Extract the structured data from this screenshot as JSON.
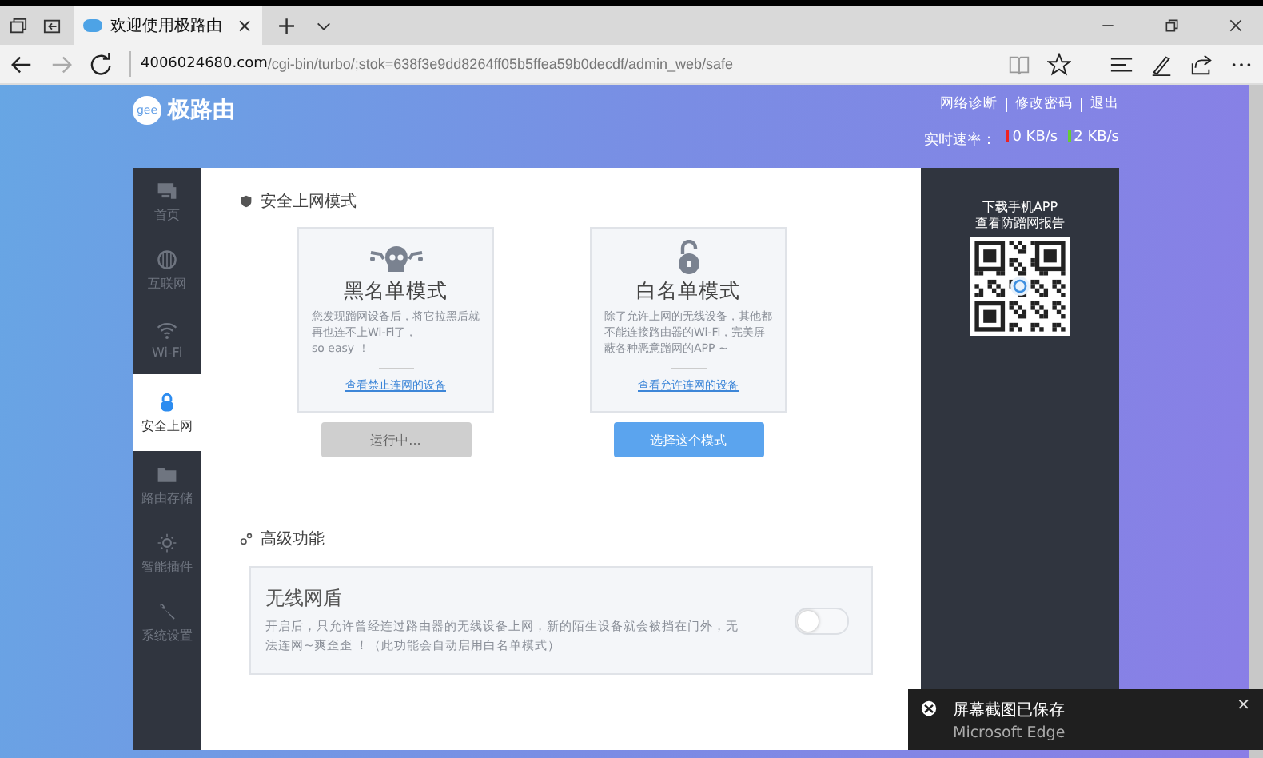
{
  "browser": {
    "tab": {
      "title": "欢迎使用极路由",
      "close": "×"
    },
    "new_tab": "+",
    "address": {
      "host": "4006024680.com",
      "path": "/cgi-bin/turbo/;stok=638f3e9dd8264ff05b5ffea59b0decdf/admin_web/safe"
    }
  },
  "header": {
    "brand": "极路由",
    "logo_text": "gee",
    "links": [
      "网络诊断",
      "修改密码",
      "退出"
    ],
    "speed_label": "实时速率：",
    "upload": "0 KB/s",
    "download": "2 KB/s"
  },
  "sidebar": {
    "items": [
      {
        "label": "首页",
        "kind": "monitor",
        "selected": false
      },
      {
        "label": "互联网",
        "kind": "globe",
        "selected": false
      },
      {
        "label": "Wi-Fi",
        "kind": "wifi",
        "selected": false
      },
      {
        "label": "安全上网",
        "kind": "lock",
        "selected": true
      },
      {
        "label": "路由存储",
        "kind": "folder",
        "selected": false
      },
      {
        "label": "智能插件",
        "kind": "bulb",
        "selected": false
      },
      {
        "label": "系统设置",
        "kind": "wrench",
        "selected": false
      }
    ]
  },
  "safe_mode": {
    "title": "安全上网模式",
    "modes": [
      {
        "kind": "skull",
        "title": "黑名单模式",
        "description": "您发现蹭网设备后，将它拉黑后就再也连不上Wi-Fi了，\nso easy ！",
        "link": "查看禁止连网的设备",
        "button": "运行中...",
        "active": true
      },
      {
        "kind": "lock",
        "title": "白名单模式",
        "description": "除了允许上网的无线设备，其他都不能连接路由器的Wi-Fi，完美屏蔽各种恶意蹭网的APP ~",
        "link": "查看允许连网的设备",
        "button": "选择这个模式",
        "active": false
      }
    ]
  },
  "advanced": {
    "title": "高级功能",
    "feature": {
      "title": "无线网盾",
      "description": "开启后，只允许曾经连过路由器的无线设备上网，新的陌生设备就会被挡在门外，无法连网~爽歪歪 ！（此功能会自动启用白名单模式）",
      "on": false
    }
  },
  "app_panel": {
    "lines": [
      "下载手机APP",
      "查看防蹭网报告"
    ]
  },
  "toast": {
    "title": "屏幕截图已保存",
    "app": "Microsoft Edge",
    "close": "✕"
  }
}
